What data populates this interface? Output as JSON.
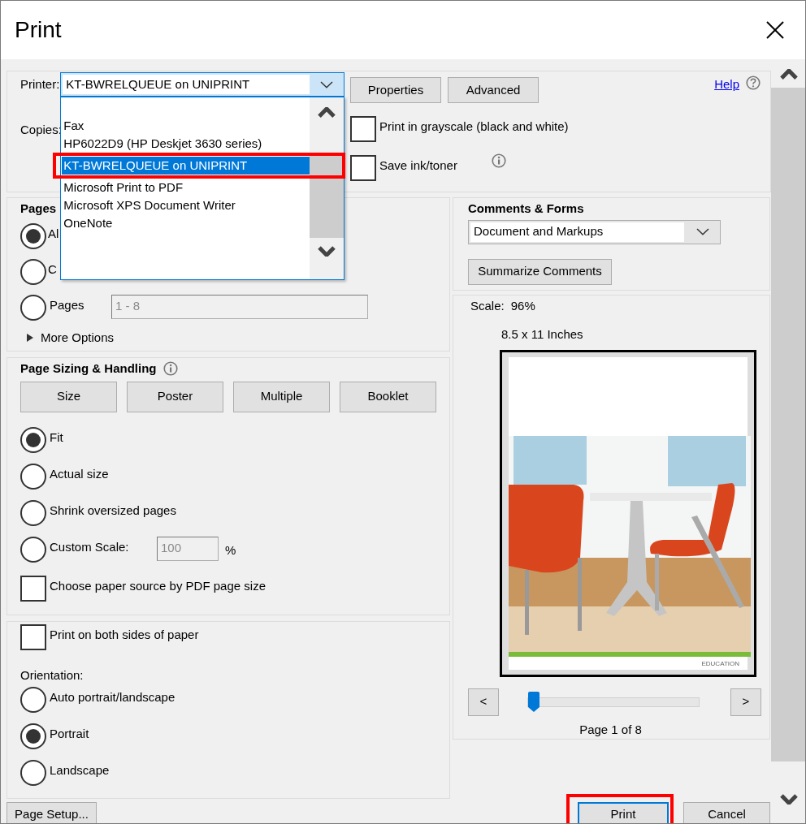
{
  "window": {
    "title": "Print"
  },
  "printer": {
    "label": "Printer:",
    "value": "KT-BWRELQUEUE on UNIPRINT",
    "expanded": true,
    "options": [
      {
        "label": "Fax",
        "selected": false
      },
      {
        "label": "HP6022D9 (HP Deskjet 3630 series)",
        "selected": false
      },
      {
        "label": "KT-BWRELQUEUE on UNIPRINT",
        "selected": true,
        "highlighted": true
      },
      {
        "label": "Microsoft Print to PDF",
        "selected": false
      },
      {
        "label": "Microsoft XPS Document Writer",
        "selected": false
      },
      {
        "label": "OneNote",
        "selected": false
      }
    ]
  },
  "header_buttons": [
    "Properties",
    "Advanced"
  ],
  "help": "Help",
  "copies": {
    "label": "Copies:"
  },
  "options": [
    {
      "label": "Print in grayscale (black and white)",
      "checked": false
    },
    {
      "label": "Save ink/toner",
      "checked": false,
      "info": true
    }
  ],
  "pages_to_print": {
    "title": "Pages",
    "choices": [
      {
        "label": "Al",
        "selected": true
      },
      {
        "label": "C",
        "selected": false
      },
      {
        "label": "Pages",
        "selected": false,
        "field_value": "1 - 8"
      }
    ],
    "more_options": "More Options"
  },
  "page_sizing": {
    "title": "Page Sizing & Handling",
    "modes": [
      "Size",
      "Poster",
      "Multiple",
      "Booklet"
    ],
    "choices": [
      {
        "label": "Fit",
        "selected": true
      },
      {
        "label": "Actual size",
        "selected": false
      },
      {
        "label": "Shrink oversized pages",
        "selected": false
      },
      {
        "label": "Custom Scale:",
        "selected": false,
        "field_value": "100",
        "unit": "%"
      }
    ],
    "paper_source": {
      "label": "Choose paper source by PDF page size",
      "checked": false
    }
  },
  "duplex": {
    "label": "Print on both sides of paper",
    "checked": false
  },
  "orientation": {
    "label": "Orientation:",
    "choices": [
      {
        "label": "Auto portrait/landscape",
        "selected": false
      },
      {
        "label": "Portrait",
        "selected": true
      },
      {
        "label": "Landscape",
        "selected": false
      }
    ]
  },
  "comments_forms": {
    "title": "Comments & Forms",
    "value": "Document and Markups",
    "summarize": "Summarize Comments"
  },
  "preview": {
    "scale_label": "Scale:",
    "scale_value": "96%",
    "paper_size": "8.5 x 11 Inches",
    "page_footer": "EDUCATION",
    "prev": "<",
    "next": ">",
    "level": 0,
    "page_label": "Page 1 of 8"
  },
  "buttons": [
    {
      "label": "Page Setup...",
      "default": false
    },
    {
      "label": "Print",
      "default": true,
      "highlighted": true
    },
    {
      "label": "Cancel",
      "default": false
    }
  ]
}
